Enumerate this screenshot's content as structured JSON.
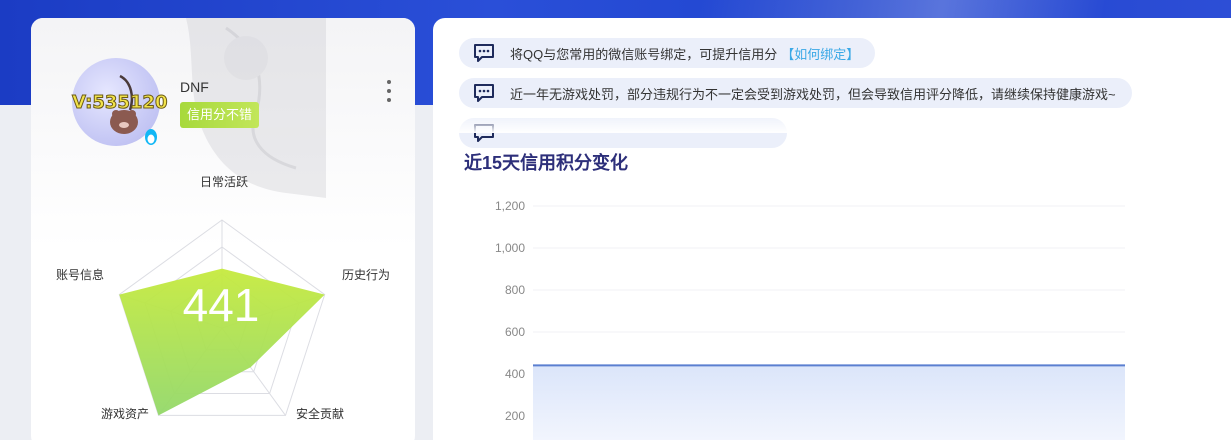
{
  "profile": {
    "avatar_watermark": "V:535120",
    "name": "DNF",
    "credit_level": "信用分不错",
    "more_icon": "more-vertical-icon",
    "qq_icon": "qq-penguin-icon"
  },
  "radar": {
    "score": "441",
    "axes": [
      {
        "label": "日常活跃",
        "value": 0.55
      },
      {
        "label": "历史行为",
        "value": 1.0
      },
      {
        "label": "安全贡献",
        "value": 0.45
      },
      {
        "label": "游戏资产",
        "value": 1.0
      },
      {
        "label": "账号信息",
        "value": 1.0
      }
    ],
    "fill_colors": [
      "#b9e640",
      "#9fdc5a"
    ]
  },
  "notices": [
    {
      "text": "将QQ与您常用的微信账号绑定，可提升信用分",
      "link": "【如何绑定】",
      "icon": "chat-bubble-icon"
    },
    {
      "text": "近一年无游戏处罚，部分违规行为不一定会受到游戏处罚，但会导致信用评分降低，请继续保持健康游戏~",
      "link": "",
      "icon": "chat-bubble-icon"
    },
    {
      "text": "",
      "link": "",
      "icon": "chat-bubble-icon"
    }
  ],
  "chart": {
    "title": "近15天信用积分变化"
  },
  "chart_data": {
    "type": "area",
    "title": "近15天信用积分变化",
    "xlabel": "",
    "ylabel": "",
    "ylim": [
      200,
      1200
    ],
    "yticks": [
      "1,200",
      "1,000",
      "800",
      "600",
      "400",
      "200"
    ],
    "ytick_values": [
      1200,
      1000,
      800,
      600,
      400,
      200
    ],
    "grid": true,
    "series": [
      {
        "values": [
          441,
          441,
          441,
          441,
          441,
          441,
          441,
          441,
          441,
          441,
          441,
          441,
          441,
          441,
          441
        ]
      }
    ],
    "line_color": "#5b7fd0",
    "area_color": "#dfe8fb"
  }
}
